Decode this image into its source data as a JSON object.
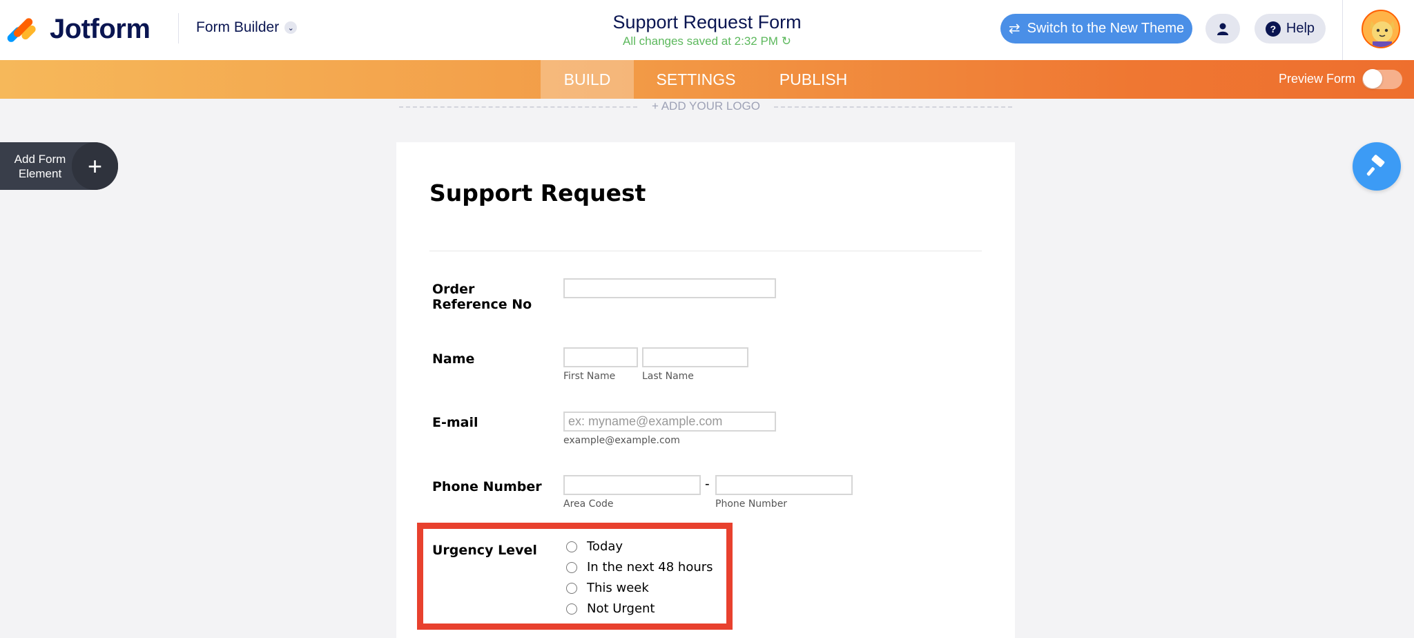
{
  "header": {
    "logo_text": "Jotform",
    "builder_menu_label": "Form Builder",
    "form_title": "Support Request Form",
    "save_status": "All changes saved at 2:32 PM",
    "switch_theme_label": "Switch to the New Theme",
    "help_label": "Help"
  },
  "nav": {
    "tabs": [
      {
        "label": "BUILD",
        "active": true
      },
      {
        "label": "SETTINGS",
        "active": false
      },
      {
        "label": "PUBLISH",
        "active": false
      }
    ],
    "preview_label": "Preview Form",
    "preview_on": false
  },
  "canvas": {
    "add_logo_label": "+ ADD YOUR LOGO",
    "add_element_label": "Add Form Element"
  },
  "form": {
    "heading": "Support Request",
    "fields": {
      "order_ref": {
        "label": "Order Reference No"
      },
      "name": {
        "label": "Name",
        "first_sub": "First Name",
        "last_sub": "Last Name"
      },
      "email": {
        "label": "E-mail",
        "placeholder": "ex: myname@example.com",
        "sub": "example@example.com"
      },
      "phone": {
        "label": "Phone Number",
        "separator": "-",
        "area_sub": "Area Code",
        "number_sub": "Phone Number"
      },
      "urgency": {
        "label": "Urgency Level",
        "options": [
          "Today",
          "In the next 48 hours",
          "This week",
          "Not Urgent"
        ]
      }
    }
  },
  "colors": {
    "highlight": "#e8412e",
    "switch_button": "#4a8fe7",
    "saved_text": "#5cb85c"
  }
}
